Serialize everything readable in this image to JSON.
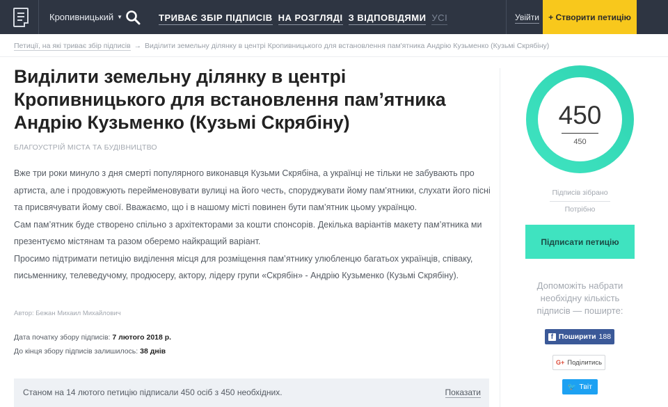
{
  "header": {
    "city": "Кропивницький",
    "nav": [
      {
        "label": "ТРИВАЄ ЗБІР ПІДПИСІВ"
      },
      {
        "label": "НА РОЗГЛЯДІ"
      },
      {
        "label": "З ВІДПОВІДЯМИ"
      },
      {
        "label": "УСІ"
      }
    ],
    "login": "Увійти",
    "create_petition": "+ Створити петицію"
  },
  "breadcrumb": {
    "link": "Петиції, на які триває збір підписів",
    "arrow": "→",
    "current": "Виділити земельну ділянку в центрі Кропивницького для встановлення пам'ятника Андрію Кузьменко (Кузьмі Скрябіну)"
  },
  "petition": {
    "title": "Виділити земельну ділянку в центрі Кропивницького для встановлення пам’ятника Андрію Кузьменко (Кузьмі Скрябіну)",
    "category": "БЛАГОУСТРІЙ МІСТА ТА БУДІВНИЦТВО",
    "paragraphs": [
      "Вже три роки минуло з дня смерті популярного виконавця Кузьми Скрябіна, а українці не тільки не забувають про артиста, але і продовжують перейменовувати вулиці на його честь, споруджувати йому пам’ятники, слухати його пісні та присвячувати йому свої. Вважаємо, що і в нашому місті повинен бути пам’ятник цьому українцю.",
      "Сам пам’ятник буде створено спільно з архітекторами за кошти спонсорів. Декілька варіантів макету пам’ятника ми презентуємо містянам та разом оберемо найкращий варіант.",
      "Просимо підтримати петицію виділення місця для розміщення пам’ятнику улюбленцю багатьох українців, співаку, письменнику, телеведучому, продюсеру, актору, лідеру групи «Скрябін» - Андрію Кузьменко (Кузьмі Скрябіну)."
    ],
    "author": "Автор: Бежан Михаил Михайлович",
    "start_label": "Дата початку збору підписів:",
    "start_value": "7 лютого 2018 р.",
    "remaining_label": "До кінця збору підписів залишилось:",
    "remaining_value": "38 днів",
    "status_text": "Станом на 14 лютого петицію підписали 450 осіб з 450 необхідних.",
    "status_show": "Показати"
  },
  "sidebar": {
    "collected_label": "Підписів зібрано",
    "needed_label": "Потрібно",
    "sign_button": "Підписати петицію",
    "help_text": "Допоможіть набрати необхідну кількість підписів — поширте:",
    "fb_label": "Поширити",
    "fb_count": "188",
    "gp_label": "Поділитись",
    "gp_icon": "G+",
    "tw_label": "Твіт",
    "ring_color_start": "#3fe3c0",
    "ring_color_end": "#2fd4b2"
  },
  "chart_data": {
    "type": "pie",
    "collected": 450,
    "needed": 450,
    "collected_label": "450",
    "needed_label": "450"
  }
}
